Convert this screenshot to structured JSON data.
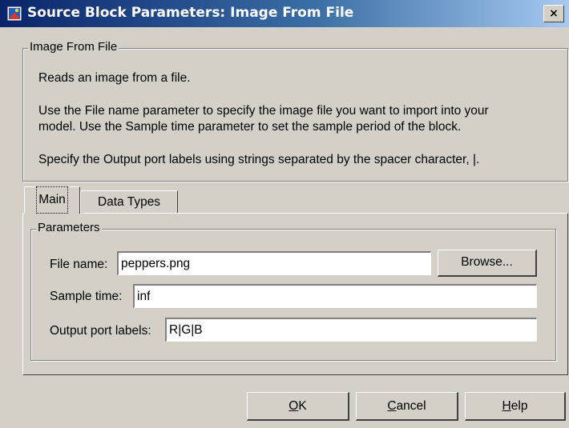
{
  "window": {
    "title": "Source Block Parameters: Image From File",
    "close_glyph": "×"
  },
  "description": {
    "group_label": "Image From File",
    "line1": "Reads an image from a file.",
    "line2a": "Use the File name parameter to specify the image file you want to import into your",
    "line2b": "model. Use the Sample time parameter to set the sample period of the block.",
    "line3": "Specify the Output port labels using strings separated by the spacer character, |."
  },
  "tabs": [
    {
      "label": "Main",
      "selected": true
    },
    {
      "label": "Data Types",
      "selected": false
    }
  ],
  "parameters": {
    "group_label": "Parameters",
    "file_name_label": "File name:",
    "file_name_value": "peppers.png",
    "browse_label": "Browse...",
    "sample_time_label": "Sample time:",
    "sample_time_value": "inf",
    "output_labels_label": "Output port labels:",
    "output_labels_value": "R|G|B"
  },
  "buttons": {
    "ok_mnemonic": "O",
    "ok_rest": "K",
    "cancel_mnemonic": "C",
    "cancel_rest": "ancel",
    "help_mnemonic": "H",
    "help_rest": "elp"
  },
  "icons": {
    "title": "simulink-block-icon",
    "close": "close-icon"
  },
  "colors": {
    "titlebar_start": "#0a246a",
    "titlebar_end": "#a6caf0",
    "dialog_bg": "#d4d0c8"
  }
}
